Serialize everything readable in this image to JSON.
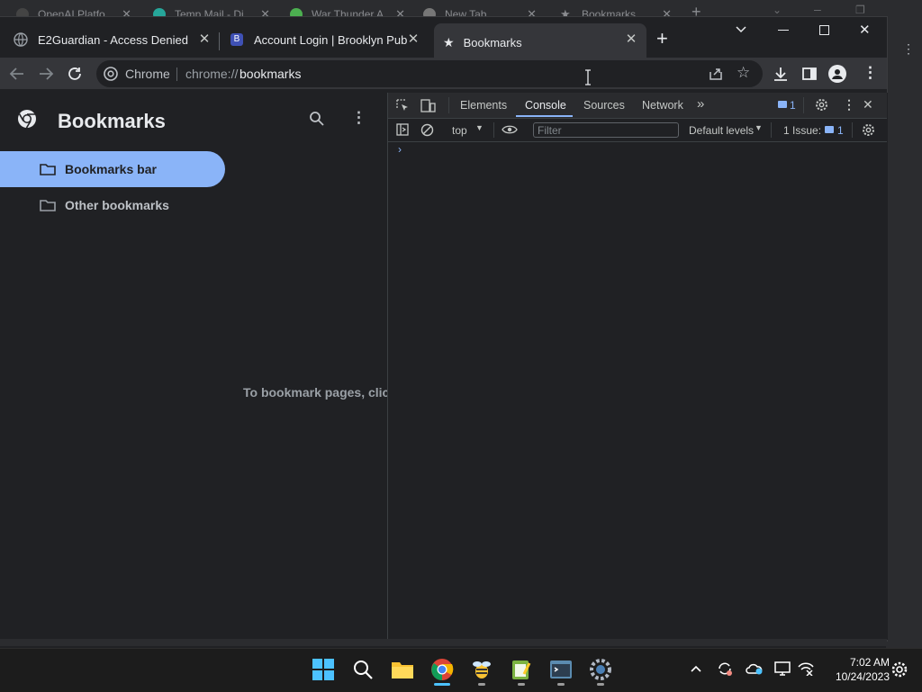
{
  "background_window": {
    "tabs": [
      "OpenAI Platfo",
      "Temp Mail - Di",
      "War Thunder A",
      "New Tab",
      "Bookmarks"
    ]
  },
  "browser": {
    "tabs": [
      {
        "label": "E2Guardian - Access Denied",
        "active": false
      },
      {
        "label": "Account Login | Brooklyn Public",
        "active": false
      },
      {
        "label": "Bookmarks",
        "active": true
      }
    ],
    "new_tab_symbol": "+",
    "omnibox": {
      "site_label": "Chrome",
      "url_scheme": "chrome://",
      "url_path": "bookmarks"
    }
  },
  "bookmarks_page": {
    "title": "Bookmarks",
    "folders": [
      {
        "label": "Bookmarks bar",
        "selected": true
      },
      {
        "label": "Other bookmarks",
        "selected": false
      }
    ],
    "empty_message": "To bookmark pages, click"
  },
  "devtools": {
    "tabs": [
      "Elements",
      "Console",
      "Sources",
      "Network"
    ],
    "active_tab": "Console",
    "messages_badge": "1",
    "context": "top",
    "filter_placeholder": "Filter",
    "levels": "Default levels",
    "issues_label": "1 Issue:",
    "issues_count": "1",
    "prompt": "›"
  },
  "taskbar": {
    "time": "7:02 AM",
    "date": "10/24/2023"
  },
  "colors": {
    "accent": "#8ab4f8",
    "surface": "#202124",
    "toolbar": "#35363a"
  }
}
